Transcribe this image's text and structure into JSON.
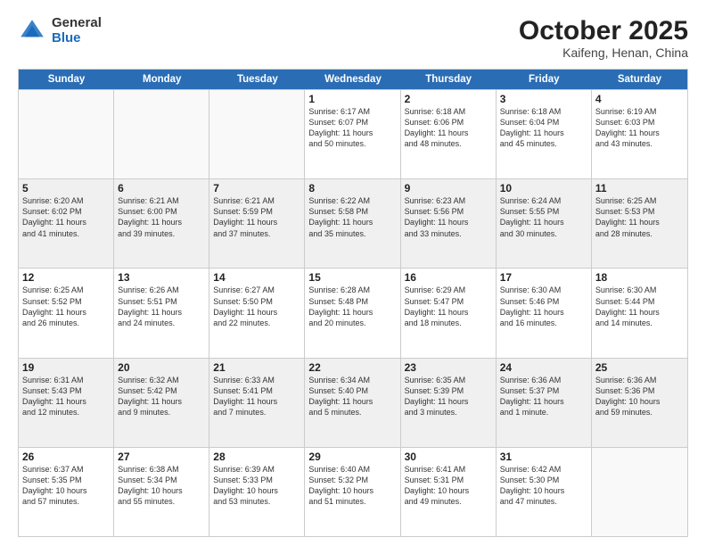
{
  "header": {
    "logo_general": "General",
    "logo_blue": "Blue",
    "month_title": "October 2025",
    "location": "Kaifeng, Henan, China"
  },
  "calendar": {
    "days_of_week": [
      "Sunday",
      "Monday",
      "Tuesday",
      "Wednesday",
      "Thursday",
      "Friday",
      "Saturday"
    ],
    "rows": [
      [
        {
          "day": "",
          "text": "",
          "empty": true
        },
        {
          "day": "",
          "text": "",
          "empty": true
        },
        {
          "day": "",
          "text": "",
          "empty": true
        },
        {
          "day": "1",
          "text": "Sunrise: 6:17 AM\nSunset: 6:07 PM\nDaylight: 11 hours\nand 50 minutes.",
          "empty": false
        },
        {
          "day": "2",
          "text": "Sunrise: 6:18 AM\nSunset: 6:06 PM\nDaylight: 11 hours\nand 48 minutes.",
          "empty": false
        },
        {
          "day": "3",
          "text": "Sunrise: 6:18 AM\nSunset: 6:04 PM\nDaylight: 11 hours\nand 45 minutes.",
          "empty": false
        },
        {
          "day": "4",
          "text": "Sunrise: 6:19 AM\nSunset: 6:03 PM\nDaylight: 11 hours\nand 43 minutes.",
          "empty": false
        }
      ],
      [
        {
          "day": "5",
          "text": "Sunrise: 6:20 AM\nSunset: 6:02 PM\nDaylight: 11 hours\nand 41 minutes.",
          "empty": false
        },
        {
          "day": "6",
          "text": "Sunrise: 6:21 AM\nSunset: 6:00 PM\nDaylight: 11 hours\nand 39 minutes.",
          "empty": false
        },
        {
          "day": "7",
          "text": "Sunrise: 6:21 AM\nSunset: 5:59 PM\nDaylight: 11 hours\nand 37 minutes.",
          "empty": false
        },
        {
          "day": "8",
          "text": "Sunrise: 6:22 AM\nSunset: 5:58 PM\nDaylight: 11 hours\nand 35 minutes.",
          "empty": false
        },
        {
          "day": "9",
          "text": "Sunrise: 6:23 AM\nSunset: 5:56 PM\nDaylight: 11 hours\nand 33 minutes.",
          "empty": false
        },
        {
          "day": "10",
          "text": "Sunrise: 6:24 AM\nSunset: 5:55 PM\nDaylight: 11 hours\nand 30 minutes.",
          "empty": false
        },
        {
          "day": "11",
          "text": "Sunrise: 6:25 AM\nSunset: 5:53 PM\nDaylight: 11 hours\nand 28 minutes.",
          "empty": false
        }
      ],
      [
        {
          "day": "12",
          "text": "Sunrise: 6:25 AM\nSunset: 5:52 PM\nDaylight: 11 hours\nand 26 minutes.",
          "empty": false
        },
        {
          "day": "13",
          "text": "Sunrise: 6:26 AM\nSunset: 5:51 PM\nDaylight: 11 hours\nand 24 minutes.",
          "empty": false
        },
        {
          "day": "14",
          "text": "Sunrise: 6:27 AM\nSunset: 5:50 PM\nDaylight: 11 hours\nand 22 minutes.",
          "empty": false
        },
        {
          "day": "15",
          "text": "Sunrise: 6:28 AM\nSunset: 5:48 PM\nDaylight: 11 hours\nand 20 minutes.",
          "empty": false
        },
        {
          "day": "16",
          "text": "Sunrise: 6:29 AM\nSunset: 5:47 PM\nDaylight: 11 hours\nand 18 minutes.",
          "empty": false
        },
        {
          "day": "17",
          "text": "Sunrise: 6:30 AM\nSunset: 5:46 PM\nDaylight: 11 hours\nand 16 minutes.",
          "empty": false
        },
        {
          "day": "18",
          "text": "Sunrise: 6:30 AM\nSunset: 5:44 PM\nDaylight: 11 hours\nand 14 minutes.",
          "empty": false
        }
      ],
      [
        {
          "day": "19",
          "text": "Sunrise: 6:31 AM\nSunset: 5:43 PM\nDaylight: 11 hours\nand 12 minutes.",
          "empty": false
        },
        {
          "day": "20",
          "text": "Sunrise: 6:32 AM\nSunset: 5:42 PM\nDaylight: 11 hours\nand 9 minutes.",
          "empty": false
        },
        {
          "day": "21",
          "text": "Sunrise: 6:33 AM\nSunset: 5:41 PM\nDaylight: 11 hours\nand 7 minutes.",
          "empty": false
        },
        {
          "day": "22",
          "text": "Sunrise: 6:34 AM\nSunset: 5:40 PM\nDaylight: 11 hours\nand 5 minutes.",
          "empty": false
        },
        {
          "day": "23",
          "text": "Sunrise: 6:35 AM\nSunset: 5:39 PM\nDaylight: 11 hours\nand 3 minutes.",
          "empty": false
        },
        {
          "day": "24",
          "text": "Sunrise: 6:36 AM\nSunset: 5:37 PM\nDaylight: 11 hours\nand 1 minute.",
          "empty": false
        },
        {
          "day": "25",
          "text": "Sunrise: 6:36 AM\nSunset: 5:36 PM\nDaylight: 10 hours\nand 59 minutes.",
          "empty": false
        }
      ],
      [
        {
          "day": "26",
          "text": "Sunrise: 6:37 AM\nSunset: 5:35 PM\nDaylight: 10 hours\nand 57 minutes.",
          "empty": false
        },
        {
          "day": "27",
          "text": "Sunrise: 6:38 AM\nSunset: 5:34 PM\nDaylight: 10 hours\nand 55 minutes.",
          "empty": false
        },
        {
          "day": "28",
          "text": "Sunrise: 6:39 AM\nSunset: 5:33 PM\nDaylight: 10 hours\nand 53 minutes.",
          "empty": false
        },
        {
          "day": "29",
          "text": "Sunrise: 6:40 AM\nSunset: 5:32 PM\nDaylight: 10 hours\nand 51 minutes.",
          "empty": false
        },
        {
          "day": "30",
          "text": "Sunrise: 6:41 AM\nSunset: 5:31 PM\nDaylight: 10 hours\nand 49 minutes.",
          "empty": false
        },
        {
          "day": "31",
          "text": "Sunrise: 6:42 AM\nSunset: 5:30 PM\nDaylight: 10 hours\nand 47 minutes.",
          "empty": false
        },
        {
          "day": "",
          "text": "",
          "empty": true
        }
      ]
    ]
  }
}
